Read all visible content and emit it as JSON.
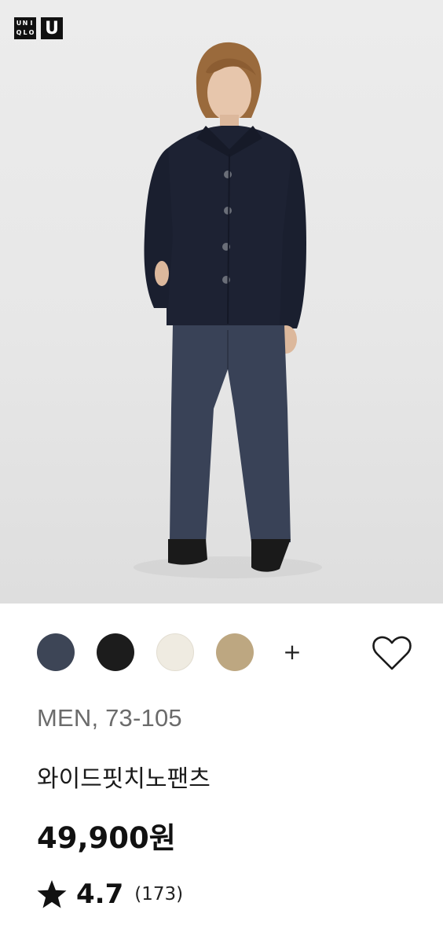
{
  "brand": {
    "logo_text": "UNIQLO",
    "logo_uniqlo_chars": [
      "U",
      "N",
      "I",
      "Q",
      "L",
      "O"
    ],
    "logo_u_label": "U"
  },
  "colors": {
    "swatches": [
      {
        "name": "navy",
        "hex": "#3d4556"
      },
      {
        "name": "black",
        "hex": "#1c1c1c"
      },
      {
        "name": "off-white",
        "hex": "#efebe1"
      },
      {
        "name": "beige",
        "hex": "#bda781"
      }
    ],
    "more_label": "+"
  },
  "product": {
    "category": "MEN, 73-105",
    "name": "와이드핏치노팬츠",
    "price": "49,900원",
    "rating": {
      "score": "4.7",
      "count": "(173)"
    }
  },
  "icons": {
    "wishlist": "heart-outline-icon",
    "rating": "star-icon"
  }
}
